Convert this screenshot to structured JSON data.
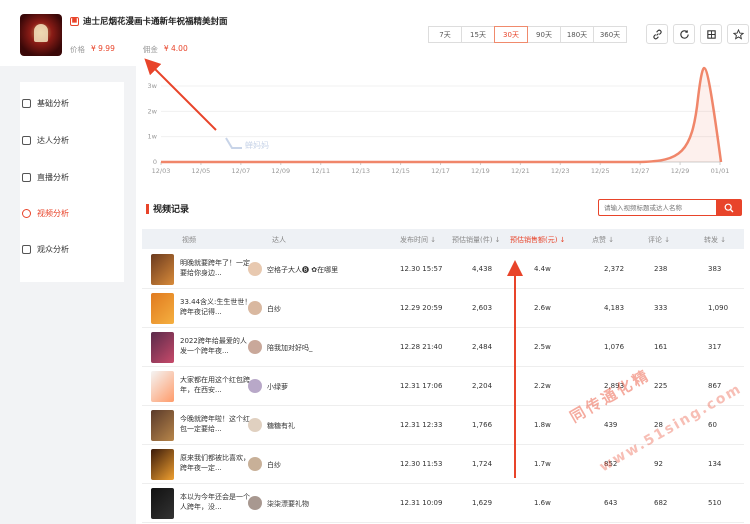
{
  "product": {
    "title": "迪士尼烟花漫画卡通新年祝福精美封面",
    "price_label": "价格",
    "price_value": "¥ 9.99",
    "commission_label": "佣金",
    "commission_value": "¥ 4.00"
  },
  "ranges": [
    "7天",
    "15天",
    "30天",
    "90天",
    "180天",
    "360天"
  ],
  "active_range": "30天",
  "op_icons": [
    "link-icon",
    "refresh-icon",
    "grid-icon",
    "star-icon"
  ],
  "sidebar": {
    "items": [
      {
        "label": "基础分析",
        "icon": "chart-icon"
      },
      {
        "label": "达人分析",
        "icon": "user-icon"
      },
      {
        "label": "直播分析",
        "icon": "tv-icon"
      },
      {
        "label": "视频分析",
        "icon": "video-icon",
        "active": true
      },
      {
        "label": "观众分析",
        "icon": "audience-icon"
      }
    ]
  },
  "chart_data": {
    "type": "area",
    "x": [
      "12/03",
      "12/05",
      "12/07",
      "12/09",
      "12/11",
      "12/13",
      "12/15",
      "12/17",
      "12/19",
      "12/21",
      "12/23",
      "12/25",
      "12/27",
      "12/29",
      "01/01"
    ],
    "y_ticks": [
      "0",
      "1w",
      "2w",
      "3w"
    ],
    "ylim": [
      0,
      30000
    ],
    "series": [
      {
        "values": [
          0,
          0,
          0,
          0,
          0,
          0,
          0,
          0,
          0,
          0,
          0,
          0,
          0,
          800,
          0
        ]
      }
    ],
    "peak": {
      "x": "12/31",
      "value": 44000
    },
    "color": "#f0866a",
    "watermark": "蝉妈妈"
  },
  "videos": {
    "section_title": "视频记录",
    "search_placeholder": "请输入视频标题或达人名称",
    "columns": {
      "video": "视频",
      "creator": "达人",
      "publish_time": "发布时间 ↓",
      "est_sales": "预估销量(件) ↓",
      "est_revenue": "预估销售额(元) ↓",
      "likes": "点赞 ↓",
      "comments": "评论 ↓",
      "shares": "转发 ↓"
    },
    "rows": [
      {
        "title": "明晚就要跨年了！一定要给你身边...",
        "creator": "空格子大人🅑 ✿在哪里",
        "time": "12.30 15:57",
        "sales": "4,438",
        "revenue": "4.4w",
        "likes": "2,372",
        "comments": "238",
        "shares": "383"
      },
      {
        "title": "33.44含义:生生世世！跨年夜记得...",
        "creator": "白纱",
        "time": "12.29 20:59",
        "sales": "2,603",
        "revenue": "2.6w",
        "likes": "4,183",
        "comments": "333",
        "shares": "1,090"
      },
      {
        "title": "2022跨年给最爱的人发一个跨年夜...",
        "creator": "陪我加对好吗_",
        "time": "12.28 21:40",
        "sales": "2,484",
        "revenue": "2.5w",
        "likes": "1,076",
        "comments": "161",
        "shares": "317"
      },
      {
        "title": "大家都在用这个红包跨年，在西安...",
        "creator": "小绿萝",
        "time": "12.31 17:06",
        "sales": "2,204",
        "revenue": "2.2w",
        "likes": "2,893",
        "comments": "225",
        "shares": "867"
      },
      {
        "title": "今晚就跨年啦！这个红包一定要给...",
        "creator": "糖糖有礼",
        "time": "12.31 12:33",
        "sales": "1,766",
        "revenue": "1.8w",
        "likes": "439",
        "comments": "28",
        "shares": "60"
      },
      {
        "title": "原来我们都被比喜欢，跨年夜一定...",
        "creator": "白纱",
        "time": "12.30 11:53",
        "sales": "1,724",
        "revenue": "1.7w",
        "likes": "852",
        "comments": "92",
        "shares": "134"
      },
      {
        "title": "本以为今年还会是一个人跨年，没...",
        "creator": "柒柒漂要礼物",
        "time": "12.31 10:09",
        "sales": "1,629",
        "revenue": "1.6w",
        "likes": "643",
        "comments": "682",
        "shares": "510"
      }
    ]
  },
  "watermark": {
    "line1": "同传通化精",
    "line2": "www.51sing.com"
  }
}
